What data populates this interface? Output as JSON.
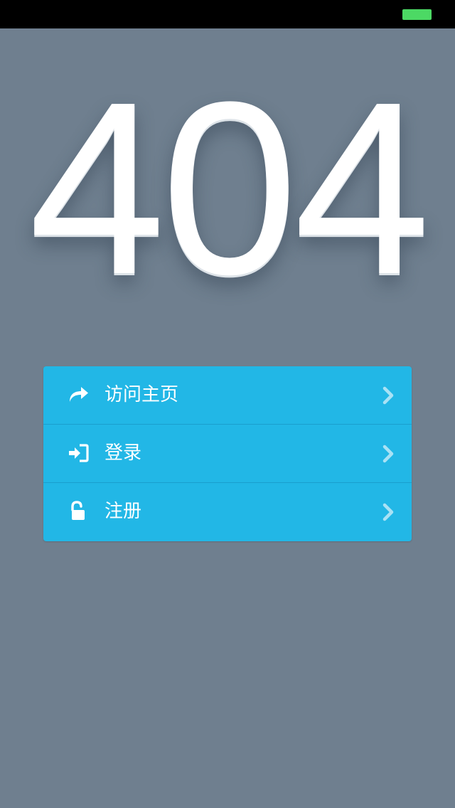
{
  "status_bar": {
    "battery_color": "#4cd964"
  },
  "error": {
    "code": "404"
  },
  "menu": {
    "accent_color": "#22b7e6",
    "items": [
      {
        "label": "访问主页",
        "icon": "share-arrow-icon"
      },
      {
        "label": "登录",
        "icon": "sign-in-icon"
      },
      {
        "label": "注册",
        "icon": "unlock-icon"
      }
    ]
  }
}
